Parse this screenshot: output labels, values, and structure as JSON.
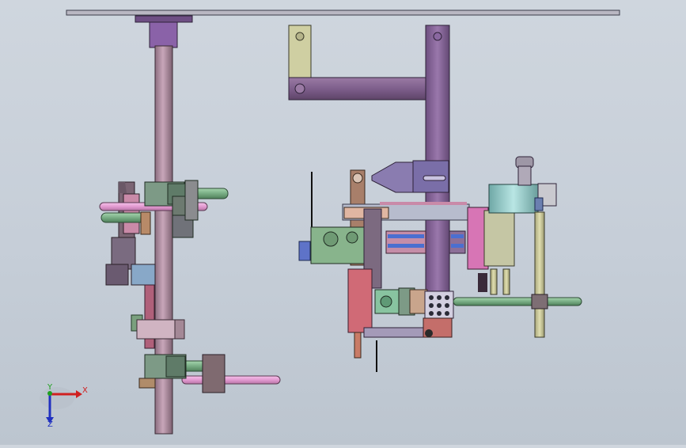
{
  "view": {
    "background_top": "#cfd6de",
    "background_bottom": "#bcc5cf"
  },
  "triad": {
    "x_label": "X",
    "y_label": "Y",
    "z_label": "Z",
    "x_color": "#d02020",
    "y_color": "#20a020",
    "z_color": "#2030c0"
  },
  "parts": {
    "column_color": "#b897aa",
    "arm_color": "#8e6aa0",
    "bracket_color": "#c9c89a",
    "clamp_color": "#7d9a86",
    "rod_pink": "#e8a0d8",
    "rod_green": "#7fb58a",
    "plate_green": "#88b48c",
    "bearing_blue": "#4b6fd0",
    "block_magenta": "#d775b5",
    "cylinder_teal": "#9fd0cf"
  }
}
